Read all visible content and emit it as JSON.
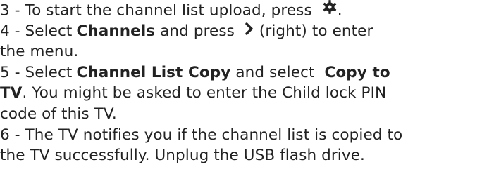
{
  "steps": {
    "s3": {
      "prefix": "3 - ",
      "text": "To start the channel list upload, press",
      "icon": "gear-icon",
      "suffix": "."
    },
    "s4": {
      "prefix": "4 - ",
      "text_a": "Select",
      "bold_a": "Channels",
      "text_b": "and press",
      "icon": "chevron-right-icon",
      "text_c": "(right) to enter",
      "text_d": "the menu."
    },
    "s5": {
      "prefix": "5 - ",
      "text_a": "Select",
      "bold_a": "Channel List Copy",
      "text_b": "and select",
      "bold_b1": "Copy to",
      "bold_b2": "TV",
      "text_c": ". You might be asked to enter the Child lock PIN",
      "text_d": "code of this TV."
    },
    "s6": {
      "prefix": "6 - ",
      "text_a": "The TV notifies you if the channel list is copied to",
      "text_b": "the TV successfully. Unplug the USB flash drive."
    }
  }
}
